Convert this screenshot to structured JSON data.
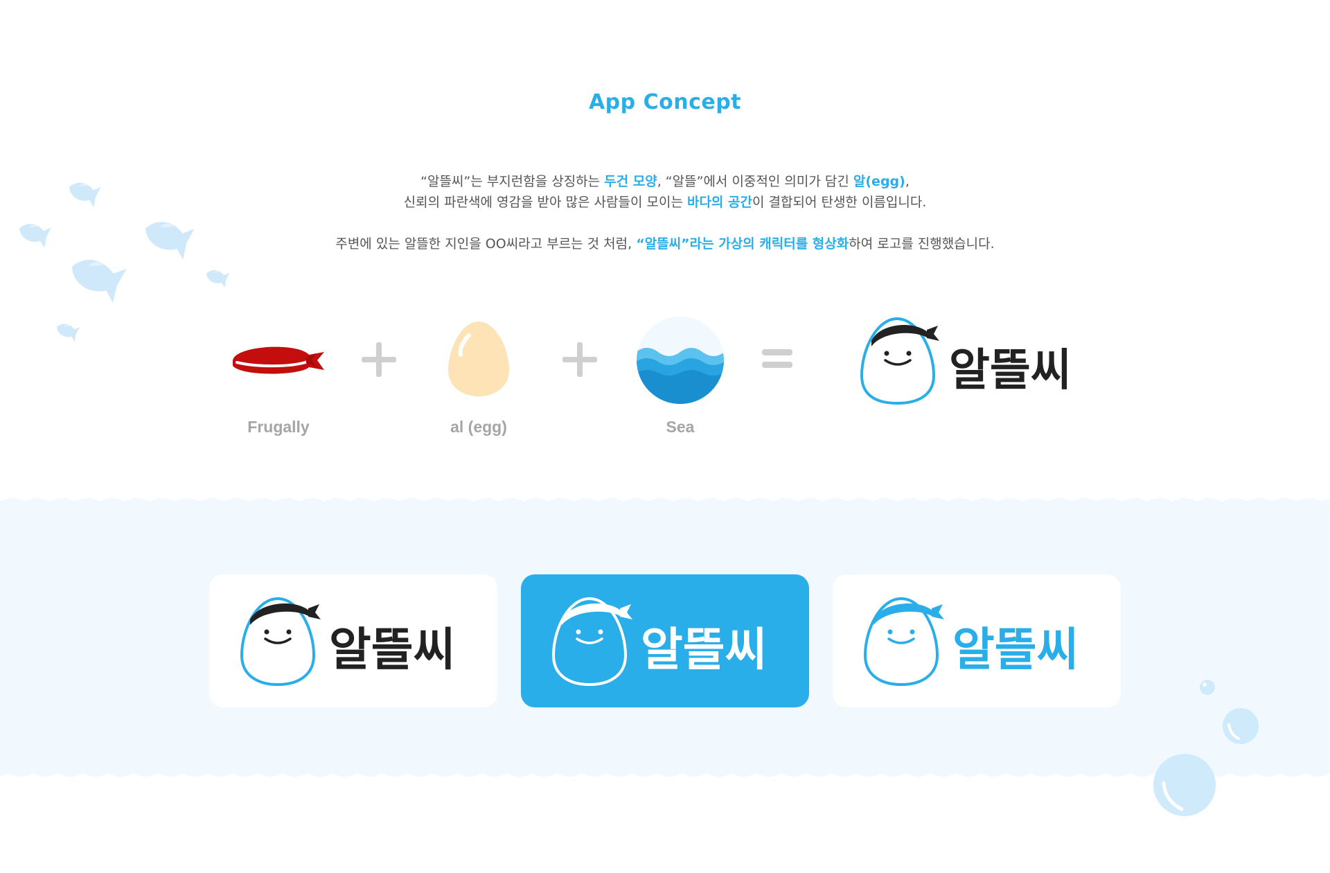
{
  "title": "App Concept",
  "description": {
    "line1": [
      {
        "text": "“알뜰씨”는 부지런함을 상징하는 ",
        "hl": false
      },
      {
        "text": "두건 모양",
        "hl": true
      },
      {
        "text": ", “알뜰”에서 이중적인 의미가 담긴 ",
        "hl": false
      },
      {
        "text": "알(egg)",
        "hl": true
      },
      {
        "text": ",",
        "hl": false
      }
    ],
    "line2": [
      {
        "text": "신뢰의 파란색에 영감을 받아 많은 사람들이 모이는 ",
        "hl": false
      },
      {
        "text": "바다의 공간",
        "hl": true
      },
      {
        "text": "이 결합되어 탄생한 이름입니다.",
        "hl": false
      }
    ],
    "line3": [
      {
        "text": "주변에 있는 알뜰한 지인을 OO씨라고 부르는 것 처럼, ",
        "hl": false
      },
      {
        "text": "“알뜰씨”라는 가상의 캐릭터를 형상화",
        "hl": true
      },
      {
        "text": "하여 로고를 진행했습니다.",
        "hl": false
      }
    ]
  },
  "formula": {
    "items": [
      {
        "label": "Frugally",
        "icon": "bandana-icon"
      },
      {
        "label": "al (egg)",
        "icon": "egg-icon"
      },
      {
        "label": "Sea",
        "icon": "sea-icon"
      }
    ],
    "plus_symbol": "+",
    "equals_symbol": "=",
    "result_wordmark": "알뜰씨"
  },
  "logo_variants": [
    {
      "variant": "white-dark",
      "wordmark": "알뜰씨"
    },
    {
      "variant": "blue-reverse",
      "wordmark": "알뜰씨"
    },
    {
      "variant": "white-blue",
      "wordmark": "알뜰씨"
    }
  ],
  "colors": {
    "brand_blue": "#2aaee9",
    "band_bg": "#f1f9fe",
    "bandana_red": "#c40d0d",
    "egg_yellow": "#fde3b5",
    "label_gray": "#a5a5a5",
    "ink": "#222222"
  }
}
